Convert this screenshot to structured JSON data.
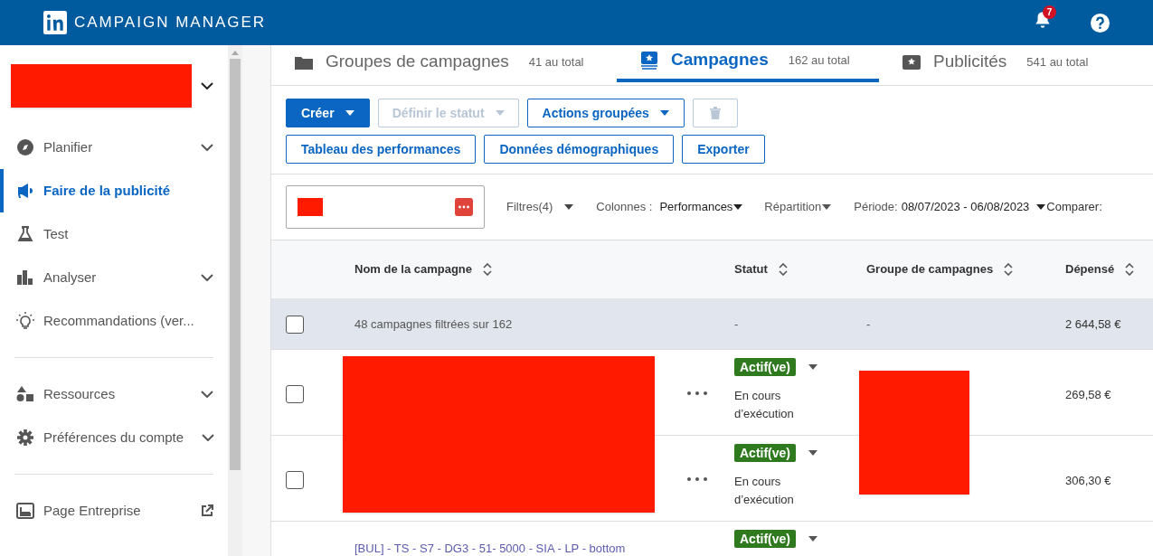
{
  "header": {
    "title": "CAMPAIGN MANAGER",
    "notifications": "7"
  },
  "sidebar": {
    "groups": [
      [
        {
          "label": "Planifier",
          "selected": false,
          "kind": "expandable"
        },
        {
          "label": "Faire de la publicité",
          "selected": true,
          "kind": "plain"
        },
        {
          "label": "Test",
          "selected": false,
          "kind": "plain"
        },
        {
          "label": "Analyser",
          "selected": false,
          "kind": "expandable"
        },
        {
          "label": "Recommandations (ver...",
          "selected": false,
          "kind": "plain"
        }
      ],
      [
        {
          "label": "Ressources",
          "selected": false,
          "kind": "expandable"
        },
        {
          "label": "Préférences du compte",
          "selected": false,
          "kind": "expandable"
        }
      ],
      [
        {
          "label": "Page Entreprise",
          "selected": false,
          "kind": "external"
        }
      ]
    ]
  },
  "tabs": [
    {
      "label": "Groupes de campagnes",
      "count": "41 au total",
      "selected": false
    },
    {
      "label": "Campagnes",
      "count": "162 au total",
      "selected": true
    },
    {
      "label": "Publicités",
      "count": "541 au total",
      "selected": false
    }
  ],
  "toolbar": [
    [
      {
        "label": "Créer",
        "caret": true,
        "disabled": false,
        "primary": true
      },
      {
        "label": "Définir le statut",
        "caret": true,
        "disabled": true,
        "primary": false
      },
      {
        "label": "Actions groupées",
        "caret": true,
        "disabled": false,
        "primary": false
      },
      {
        "kind": "delete",
        "disabled": true
      }
    ],
    [
      {
        "label": "Tableau des performances",
        "caret": false,
        "disabled": false,
        "primary": false
      },
      {
        "label": "Données démographiques",
        "caret": false,
        "disabled": false,
        "primary": false
      },
      {
        "label": "Exporter",
        "caret": false,
        "disabled": false,
        "primary": false
      }
    ]
  ],
  "filters": {
    "filter": "Filtres(4)",
    "columns_label": "Colonnes :",
    "columns_value": "Performances",
    "breakdown": "Répartition",
    "period_label": "Période:",
    "period_value": "08/07/2023 - 06/08/2023",
    "compare": "Comparer:"
  },
  "table": {
    "columns": [
      "Nom de la campagne",
      "Statut",
      "Groupe de campagnes",
      "Dépensé"
    ],
    "summary": {
      "label": "48 campagnes filtrées sur 162",
      "checked": false,
      "status": "-",
      "group": "-",
      "spent": "2 644,58 €"
    },
    "rows": [
      {
        "checked": false,
        "status": "Actif(ve)",
        "substatus": "En cours d’exécution",
        "spent": "269,58 €"
      },
      {
        "checked": false,
        "status": "Actif(ve)",
        "substatus": "En cours d’exécution",
        "spent": "306,30 €"
      },
      {
        "name": "[BUL] - TS - S7 - DG3 - 51- 5000 - SIA - LP - bottom",
        "status": "Actif(ve)"
      }
    ]
  }
}
